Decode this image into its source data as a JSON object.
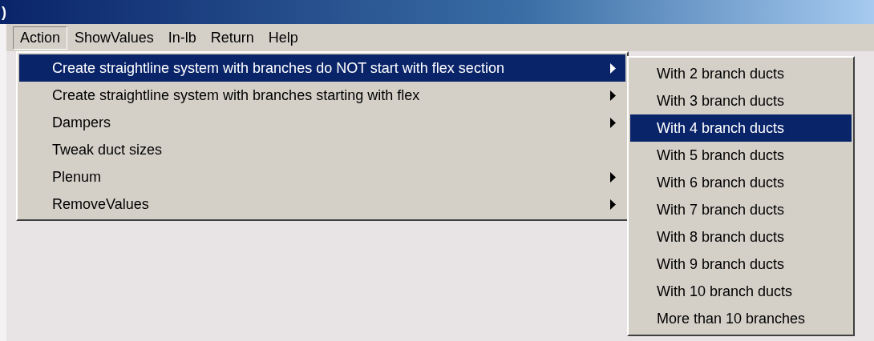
{
  "window": {
    "title": ")"
  },
  "menu_bar": [
    {
      "label": "Action",
      "selected": true
    },
    {
      "label": "ShowValues",
      "selected": false
    },
    {
      "label": "In-lb",
      "selected": false
    },
    {
      "label": "Return",
      "selected": false
    },
    {
      "label": "Help",
      "selected": false
    }
  ],
  "dropdown": [
    {
      "label": "Create straightline system with branches do NOT start with flex section",
      "has_submenu": true,
      "selected": true
    },
    {
      "label": "Create straightline system with branches starting with flex",
      "has_submenu": true,
      "selected": false
    },
    {
      "label": "Dampers",
      "has_submenu": true,
      "selected": false
    },
    {
      "label": "Tweak duct sizes",
      "has_submenu": false,
      "selected": false
    },
    {
      "label": "Plenum",
      "has_submenu": true,
      "selected": false
    },
    {
      "label": "RemoveValues",
      "has_submenu": true,
      "selected": false
    }
  ],
  "submenu": [
    {
      "label": "With 2 branch ducts",
      "selected": false
    },
    {
      "label": "With 3 branch ducts",
      "selected": false
    },
    {
      "label": "With 4 branch ducts",
      "selected": true
    },
    {
      "label": "With 5 branch ducts",
      "selected": false
    },
    {
      "label": "With 6 branch ducts",
      "selected": false
    },
    {
      "label": "With 7 branch ducts",
      "selected": false
    },
    {
      "label": "With 8 branch ducts",
      "selected": false
    },
    {
      "label": "With 9 branch ducts",
      "selected": false
    },
    {
      "label": "With 10 branch ducts",
      "selected": false
    },
    {
      "label": "More than 10 branches",
      "selected": false
    }
  ]
}
